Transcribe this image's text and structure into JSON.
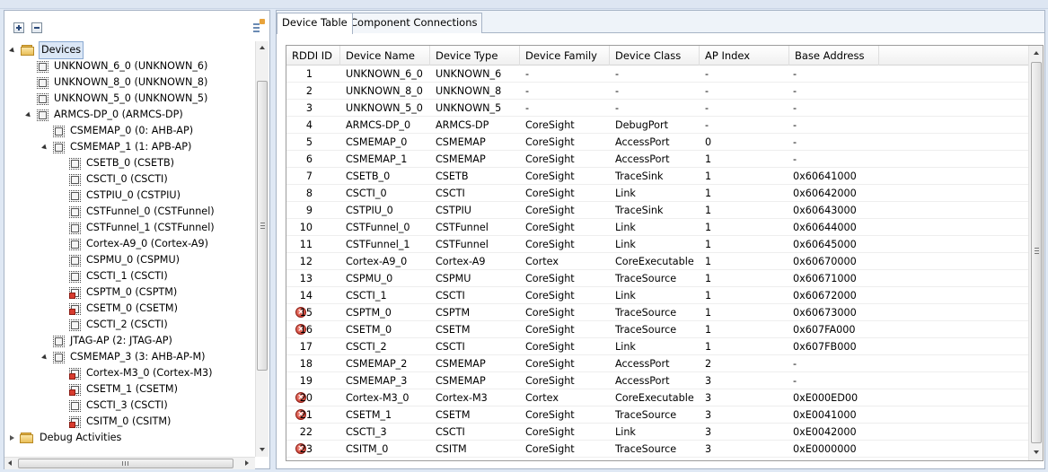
{
  "tree": {
    "items": [
      {
        "label": "Devices",
        "level": 0,
        "icon": "folder-icon",
        "expanded": true,
        "selected": true
      },
      {
        "label": "UNKNOWN_6_0 (UNKNOWN_6)",
        "level": 1,
        "icon": "chip-icon"
      },
      {
        "label": "UNKNOWN_8_0 (UNKNOWN_8)",
        "level": 1,
        "icon": "chip-icon"
      },
      {
        "label": "UNKNOWN_5_0 (UNKNOWN_5)",
        "level": 1,
        "icon": "chip-icon"
      },
      {
        "label": "ARMCS-DP_0 (ARMCS-DP)",
        "level": 1,
        "icon": "chip-icon",
        "expanded": true
      },
      {
        "label": "CSMEMAP_0 (0: AHB-AP)",
        "level": 2,
        "icon": "chip-icon"
      },
      {
        "label": "CSMEMAP_1 (1: APB-AP)",
        "level": 2,
        "icon": "chip-icon",
        "expanded": true
      },
      {
        "label": "CSETB_0 (CSETB)",
        "level": 3,
        "icon": "chip-icon"
      },
      {
        "label": "CSCTI_0 (CSCTI)",
        "level": 3,
        "icon": "chip-icon"
      },
      {
        "label": "CSTPIU_0 (CSTPIU)",
        "level": 3,
        "icon": "chip-icon"
      },
      {
        "label": "CSTFunnel_0 (CSTFunnel)",
        "level": 3,
        "icon": "chip-icon"
      },
      {
        "label": "CSTFunnel_1 (CSTFunnel)",
        "level": 3,
        "icon": "chip-icon"
      },
      {
        "label": "Cortex-A9_0 (Cortex-A9)",
        "level": 3,
        "icon": "chip-icon"
      },
      {
        "label": "CSPMU_0 (CSPMU)",
        "level": 3,
        "icon": "chip-icon"
      },
      {
        "label": "CSCTI_1 (CSCTI)",
        "level": 3,
        "icon": "chip-icon"
      },
      {
        "label": "CSPTM_0 (CSPTM)",
        "level": 3,
        "icon": "chip-error-icon"
      },
      {
        "label": "CSETM_0 (CSETM)",
        "level": 3,
        "icon": "chip-error-icon"
      },
      {
        "label": "CSCTI_2 (CSCTI)",
        "level": 3,
        "icon": "chip-icon"
      },
      {
        "label": "JTAG-AP (2: JTAG-AP)",
        "level": 2,
        "icon": "chip-icon"
      },
      {
        "label": "CSMEMAP_3 (3: AHB-AP-M)",
        "level": 2,
        "icon": "chip-icon",
        "expanded": true
      },
      {
        "label": "Cortex-M3_0 (Cortex-M3)",
        "level": 3,
        "icon": "chip-error-icon"
      },
      {
        "label": "CSETM_1 (CSETM)",
        "level": 3,
        "icon": "chip-error-icon"
      },
      {
        "label": "CSCTI_3 (CSCTI)",
        "level": 3,
        "icon": "chip-icon"
      },
      {
        "label": "CSITM_0 (CSITM)",
        "level": 3,
        "icon": "chip-error-icon"
      },
      {
        "label": "Debug Activities",
        "level": 0,
        "icon": "folder-icon",
        "expanded": false
      }
    ]
  },
  "tabs": [
    {
      "label": "Device Table",
      "active": true
    },
    {
      "label": "Component Connections",
      "active": false
    }
  ],
  "table": {
    "columns": [
      "RDDI ID",
      "Device Name",
      "Device Type",
      "Device Family",
      "Device Class",
      "AP Index",
      "Base Address"
    ],
    "rows": [
      {
        "id": "1",
        "name": "UNKNOWN_6_0",
        "type": "UNKNOWN_6",
        "family": "-",
        "class": "-",
        "ap": "-",
        "base": "-",
        "error": false
      },
      {
        "id": "2",
        "name": "UNKNOWN_8_0",
        "type": "UNKNOWN_8",
        "family": "-",
        "class": "-",
        "ap": "-",
        "base": "-",
        "error": false
      },
      {
        "id": "3",
        "name": "UNKNOWN_5_0",
        "type": "UNKNOWN_5",
        "family": "-",
        "class": "-",
        "ap": "-",
        "base": "-",
        "error": false
      },
      {
        "id": "4",
        "name": "ARMCS-DP_0",
        "type": "ARMCS-DP",
        "family": "CoreSight",
        "class": "DebugPort",
        "ap": "-",
        "base": "-",
        "error": false
      },
      {
        "id": "5",
        "name": "CSMEMAP_0",
        "type": "CSMEMAP",
        "family": "CoreSight",
        "class": "AccessPort",
        "ap": "0",
        "base": "-",
        "error": false
      },
      {
        "id": "6",
        "name": "CSMEMAP_1",
        "type": "CSMEMAP",
        "family": "CoreSight",
        "class": "AccessPort",
        "ap": "1",
        "base": "-",
        "error": false
      },
      {
        "id": "7",
        "name": "CSETB_0",
        "type": "CSETB",
        "family": "CoreSight",
        "class": "TraceSink",
        "ap": "1",
        "base": "0x60641000",
        "error": false
      },
      {
        "id": "8",
        "name": "CSCTI_0",
        "type": "CSCTI",
        "family": "CoreSight",
        "class": "Link",
        "ap": "1",
        "base": "0x60642000",
        "error": false
      },
      {
        "id": "9",
        "name": "CSTPIU_0",
        "type": "CSTPIU",
        "family": "CoreSight",
        "class": "TraceSink",
        "ap": "1",
        "base": "0x60643000",
        "error": false
      },
      {
        "id": "10",
        "name": "CSTFunnel_0",
        "type": "CSTFunnel",
        "family": "CoreSight",
        "class": "Link",
        "ap": "1",
        "base": "0x60644000",
        "error": false
      },
      {
        "id": "11",
        "name": "CSTFunnel_1",
        "type": "CSTFunnel",
        "family": "CoreSight",
        "class": "Link",
        "ap": "1",
        "base": "0x60645000",
        "error": false
      },
      {
        "id": "12",
        "name": "Cortex-A9_0",
        "type": "Cortex-A9",
        "family": "Cortex",
        "class": "CoreExecutable",
        "ap": "1",
        "base": "0x60670000",
        "error": false
      },
      {
        "id": "13",
        "name": "CSPMU_0",
        "type": "CSPMU",
        "family": "CoreSight",
        "class": "TraceSource",
        "ap": "1",
        "base": "0x60671000",
        "error": false
      },
      {
        "id": "14",
        "name": "CSCTI_1",
        "type": "CSCTI",
        "family": "CoreSight",
        "class": "Link",
        "ap": "1",
        "base": "0x60672000",
        "error": false
      },
      {
        "id": "15",
        "name": "CSPTM_0",
        "type": "CSPTM",
        "family": "CoreSight",
        "class": "TraceSource",
        "ap": "1",
        "base": "0x60673000",
        "error": true
      },
      {
        "id": "16",
        "name": "CSETM_0",
        "type": "CSETM",
        "family": "CoreSight",
        "class": "TraceSource",
        "ap": "1",
        "base": "0x607FA000",
        "error": true
      },
      {
        "id": "17",
        "name": "CSCTI_2",
        "type": "CSCTI",
        "family": "CoreSight",
        "class": "Link",
        "ap": "1",
        "base": "0x607FB000",
        "error": false
      },
      {
        "id": "18",
        "name": "CSMEMAP_2",
        "type": "CSMEMAP",
        "family": "CoreSight",
        "class": "AccessPort",
        "ap": "2",
        "base": "-",
        "error": false
      },
      {
        "id": "19",
        "name": "CSMEMAP_3",
        "type": "CSMEMAP",
        "family": "CoreSight",
        "class": "AccessPort",
        "ap": "3",
        "base": "-",
        "error": false
      },
      {
        "id": "20",
        "name": "Cortex-M3_0",
        "type": "Cortex-M3",
        "family": "Cortex",
        "class": "CoreExecutable",
        "ap": "3",
        "base": "0xE000ED00",
        "error": true
      },
      {
        "id": "21",
        "name": "CSETM_1",
        "type": "CSETM",
        "family": "CoreSight",
        "class": "TraceSource",
        "ap": "3",
        "base": "0xE0041000",
        "error": true
      },
      {
        "id": "22",
        "name": "CSCTI_3",
        "type": "CSCTI",
        "family": "CoreSight",
        "class": "Link",
        "ap": "3",
        "base": "0xE0042000",
        "error": false
      },
      {
        "id": "23",
        "name": "CSITM_0",
        "type": "CSITM",
        "family": "CoreSight",
        "class": "TraceSource",
        "ap": "3",
        "base": "0xE0000000",
        "error": true
      }
    ]
  },
  "colors": {
    "error": "#c62f22",
    "selection": "#dbe7f6",
    "panel_border": "#a7b4c6"
  }
}
